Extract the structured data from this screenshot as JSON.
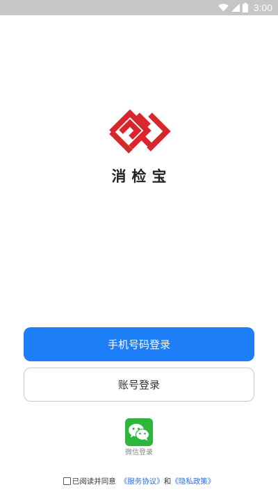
{
  "status_bar": {
    "time": "3:00",
    "icons": [
      "wifi-icon",
      "cellular-signal-icon",
      "battery-icon"
    ]
  },
  "app": {
    "name": "消检宝",
    "logo_icon": "app-logo-icon",
    "logo_color": "#d8262b"
  },
  "login": {
    "phone_button_label": "手机号码登录",
    "account_button_label": "账号登录",
    "wechat_label": "微信登录",
    "wechat_icon": "wechat-icon",
    "primary_color": "#1e7ef7",
    "wechat_color": "#2db53c"
  },
  "agreement": {
    "checked": false,
    "prefix": "已阅读并同意",
    "terms_link": "《服务协议》",
    "joiner": "和",
    "privacy_link": "《隐私政策》",
    "link_color": "#2e6fd8"
  }
}
